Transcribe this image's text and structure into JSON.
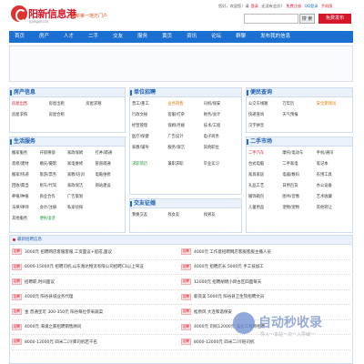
{
  "header": {
    "brand": "阳新信息港",
    "domain": "yangxin.tv",
    "slogan": "阳新第一地方门户",
    "topbar": {
      "welcome": "您好，欢迎您！请",
      "login": "登录",
      "signup_prefix": "还没有会员？",
      "signup": "免费注册",
      "qq_login": "QQ登录",
      "mobile": "手机版"
    },
    "search_placeholder": "",
    "search_button": "搜 索",
    "post_button": "免费发布"
  },
  "nav": [
    "首页",
    "房产",
    "人才",
    "二手",
    "交友",
    "服务",
    "黄页",
    "资讯",
    "论坛",
    "群聊",
    "发布我的信息"
  ],
  "panels": {
    "house": {
      "title": "房产信息",
      "items": [
        {
          "text": "房屋出售",
          "color": "red"
        },
        {
          "text": "房屋出租",
          "color": ""
        },
        {
          "text": "房屋求租",
          "color": ""
        },
        {
          "text": "房屋求购",
          "color": ""
        },
        {
          "text": "房屋合租",
          "color": ""
        },
        {
          "text": "",
          "color": ""
        }
      ]
    },
    "jobs": {
      "title": "单位招聘",
      "items": [
        {
          "text": "普工/重工",
          "color": ""
        },
        {
          "text": "业务销售",
          "color": "orange"
        },
        {
          "text": "司机/保安",
          "color": ""
        },
        {
          "text": "行政文秘",
          "color": ""
        },
        {
          "text": "客服/打杂",
          "color": ""
        },
        {
          "text": "财务/会计",
          "color": ""
        },
        {
          "text": "经营管理",
          "color": ""
        },
        {
          "text": "保姆/月嫂",
          "color": ""
        },
        {
          "text": "技术/工程",
          "color": ""
        },
        {
          "text": "医疗/保健",
          "color": ""
        },
        {
          "text": "广告设计",
          "color": ""
        },
        {
          "text": "电子商务",
          "color": ""
        },
        {
          "text": "家教/辅导",
          "color": ""
        },
        {
          "text": "服务/保洁",
          "color": ""
        },
        {
          "text": "其他职位",
          "color": ""
        },
        {
          "text": "",
          "color": ""
        },
        {
          "text": "",
          "color": ""
        },
        {
          "text": "",
          "color": ""
        },
        {
          "text": "求职简历",
          "color": "green"
        },
        {
          "text": "兼职求职",
          "color": ""
        },
        {
          "text": "毕业实习",
          "color": ""
        }
      ]
    },
    "convenience": {
      "title": "便民查询",
      "items": [
        {
          "text": "公交车线路",
          "color": ""
        },
        {
          "text": "万年历",
          "color": ""
        },
        {
          "text": "安全期测试",
          "color": "orange"
        },
        {
          "text": "快递查询",
          "color": ""
        },
        {
          "text": "天气预报",
          "color": ""
        },
        {
          "text": "",
          "color": ""
        },
        {
          "text": "汉字拼音",
          "color": ""
        },
        {
          "text": "",
          "color": ""
        },
        {
          "text": "",
          "color": ""
        }
      ]
    },
    "life": {
      "title": "生活服务",
      "items": [
        {
          "text": "搬家服务",
          "color": ""
        },
        {
          "text": "开锁换锁",
          "color": ""
        },
        {
          "text": "家政保姆",
          "color": ""
        },
        {
          "text": "打井/疏通",
          "color": ""
        },
        {
          "text": "装修/建材",
          "color": ""
        },
        {
          "text": "婚庆/摄影",
          "color": ""
        },
        {
          "text": "家电维修",
          "color": ""
        },
        {
          "text": "管道疏通",
          "color": ""
        },
        {
          "text": "搬家/快递",
          "color": ""
        },
        {
          "text": "旅游/票务",
          "color": ""
        },
        {
          "text": "家教/培训",
          "color": ""
        },
        {
          "text": "电脑维修",
          "color": ""
        },
        {
          "text": "回收/典当",
          "color": ""
        },
        {
          "text": "租车/代驾",
          "color": ""
        },
        {
          "text": "家政保洁",
          "color": ""
        },
        {
          "text": "网站建设",
          "color": ""
        },
        {
          "text": "养殖/种植",
          "color": ""
        },
        {
          "text": "商业合作",
          "color": ""
        },
        {
          "text": "广告策划",
          "color": ""
        },
        {
          "text": "",
          "color": ""
        },
        {
          "text": "法律/律师",
          "color": ""
        },
        {
          "text": "会计/注册",
          "color": ""
        },
        {
          "text": "私家侦探",
          "color": ""
        },
        {
          "text": "",
          "color": ""
        },
        {
          "text": "其他服务",
          "color": ""
        },
        {
          "text": "便民电话",
          "color": "green"
        },
        {
          "text": "",
          "color": ""
        },
        {
          "text": "",
          "color": ""
        }
      ]
    },
    "dating": {
      "title": "交友征婚",
      "items": [
        {
          "text": "我要交友",
          "color": ""
        },
        {
          "text": "找女友",
          "color": ""
        },
        {
          "text": "找男友",
          "color": ""
        }
      ]
    },
    "market": {
      "title": "二手市场",
      "items": [
        {
          "text": "二手汽车",
          "color": "red"
        },
        {
          "text": "摩托/电动车",
          "color": ""
        },
        {
          "text": "手机/通讯",
          "color": ""
        },
        {
          "text": "台式电脑",
          "color": ""
        },
        {
          "text": "二手家电",
          "color": ""
        },
        {
          "text": "笔记本",
          "color": ""
        },
        {
          "text": "家具家居",
          "color": ""
        },
        {
          "text": "电器/数码",
          "color": ""
        },
        {
          "text": "农用工具",
          "color": ""
        },
        {
          "text": "礼品工艺",
          "color": ""
        },
        {
          "text": "日用百货",
          "color": ""
        },
        {
          "text": "办公设备",
          "color": ""
        },
        {
          "text": "服饰箱包",
          "color": ""
        },
        {
          "text": "图书/音像",
          "color": ""
        },
        {
          "text": "艺术收藏",
          "color": ""
        },
        {
          "text": "儿童用品",
          "color": ""
        },
        {
          "text": "宠物/宠物",
          "color": ""
        },
        {
          "text": "其他转让",
          "color": ""
        }
      ]
    }
  },
  "news": {
    "title": "最新招聘信息",
    "tag": "招聘",
    "left": [
      "3000元 招聘网店客服客服,工资面议+提成,面议",
      "6000-15000元 招聘司机,山东潍达物流有限公司招聘C1以上驾证",
      "招聘职,时间面议",
      "4000元 阳谷县城业务代理",
      "金 普通宝可 300-350元 阳谷每位参采蔬菜",
      "4000元 海浦之家招聘销售顾问",
      "8000-12000元 四米二/冷库司机若干名"
    ],
    "right": [
      "4000元 工作意招聘网店客服客服主播人员",
      "4000元 招聘店长 5000元 手工技加工",
      "12000元 招聘胡明小目古区四面每天",
      "薪资美 5000元 阳谷县卫生院招聘文员",
      "松原风 大连和谐保安",
      "4000元 司机12000元 美业工程师招聘",
      "8000-12000元 四米二/冷链司机"
    ]
  },
  "watermark": {
    "title": "自动秒收录",
    "sub": "导入一本站一次一入导域一"
  }
}
